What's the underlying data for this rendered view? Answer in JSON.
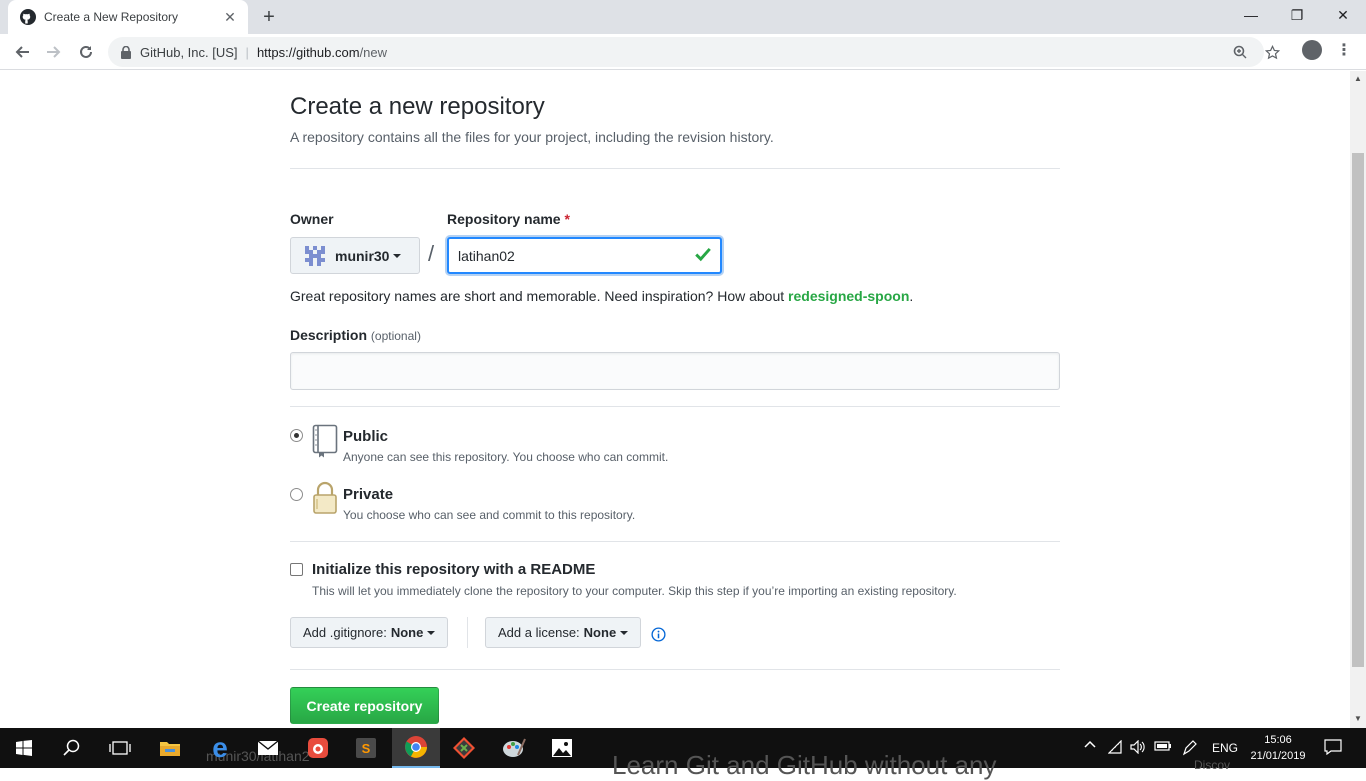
{
  "browser": {
    "tab_title": "Create a New Repository",
    "tab_close": "✕",
    "new_tab": "+",
    "controls": {
      "minimize": "—",
      "restore": "❐",
      "close": "✕"
    },
    "address": {
      "org": "GitHub, Inc. [US]",
      "separator": "|",
      "host": "https://github.com",
      "path": "/new"
    }
  },
  "page": {
    "title": "Create a new repository",
    "subtitle": "A repository contains all the files for your project, including the revision history.",
    "owner": {
      "label": "Owner",
      "value": "munir30"
    },
    "repo_name": {
      "label": "Repository name",
      "required_mark": "*",
      "value": "latihan02",
      "separator": "/"
    },
    "name_hint": {
      "text": "Great repository names are short and memorable. Need inspiration? How about",
      "suggestion": "redesigned-spoon",
      "end": "."
    },
    "description": {
      "label": "Description",
      "optional": "(optional)",
      "value": ""
    },
    "visibility": {
      "public": {
        "title": "Public",
        "desc": "Anyone can see this repository. You choose who can commit.",
        "selected": true
      },
      "private": {
        "title": "Private",
        "desc": "You choose who can see and commit to this repository.",
        "selected": false
      }
    },
    "readme": {
      "title": "Initialize this repository with a README",
      "desc": "This will let you immediately clone the repository to your computer. Skip this step if you’re importing an existing repository.",
      "checked": false
    },
    "gitignore": {
      "label": "Add .gitignore:",
      "value": "None"
    },
    "license": {
      "label": "Add a license:",
      "value": "None"
    },
    "create_button": "Create repository"
  },
  "taskbar": {
    "tray": {
      "language": "ENG"
    },
    "clock": {
      "time": "15:06",
      "date": "21/01/2019"
    },
    "ghost_texts": {
      "tab_preview": "munir30/latihan2",
      "video_title": "Learn Git and GitHub without any",
      "side": "Discov"
    }
  },
  "colors": {
    "primary_green": "#28a745",
    "focus_blue": "#2188ff",
    "required_red": "#cb2431",
    "taskbar": "#101010"
  }
}
